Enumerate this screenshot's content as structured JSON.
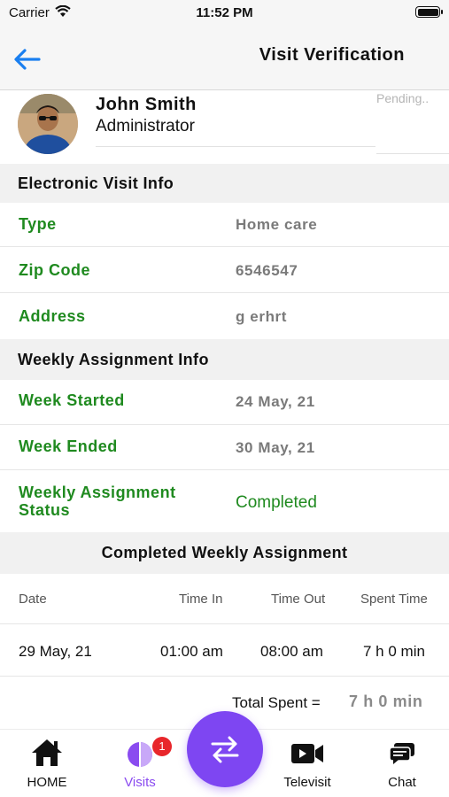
{
  "status_bar": {
    "carrier": "Carrier",
    "time": "11:52 PM"
  },
  "header": {
    "title": "Visit Verification"
  },
  "profile": {
    "name": "John Smith",
    "role": "Administrator",
    "status": "Pending.."
  },
  "electronic_visit": {
    "heading": "Electronic Visit Info",
    "rows": [
      {
        "label": "Type",
        "value": "Home care"
      },
      {
        "label": "Zip Code",
        "value": "6546547"
      },
      {
        "label": "Address",
        "value": "g erhrt"
      }
    ]
  },
  "weekly_assignment": {
    "heading": "Weekly Assignment Info",
    "rows": [
      {
        "label": "Week Started",
        "value": "24 May, 21"
      },
      {
        "label": "Week Ended",
        "value": "30 May, 21"
      },
      {
        "label": "Weekly Assignment Status",
        "value": "Completed"
      }
    ]
  },
  "completed": {
    "heading": "Completed Weekly Assignment",
    "columns": [
      "Date",
      "Time In",
      "Time Out",
      "Spent Time"
    ],
    "rows": [
      [
        "29 May, 21",
        "01:00 am",
        "08:00 am",
        "7 h 0 min"
      ]
    ],
    "total_label": "Total Spent =",
    "total_value": "7 h 0 min"
  },
  "tabs": [
    {
      "label": "HOME",
      "icon": "home-icon"
    },
    {
      "label": "Visits",
      "icon": "visits-icon",
      "badge": "1"
    },
    {
      "label": "Televisit",
      "icon": "video-camera-icon"
    },
    {
      "label": "Chat",
      "icon": "chat-icon"
    }
  ],
  "colors": {
    "accent": "#7e46f2",
    "label_green": "#1f8a1f",
    "back_blue": "#1a7ff0",
    "badge_red": "#e8262b"
  }
}
